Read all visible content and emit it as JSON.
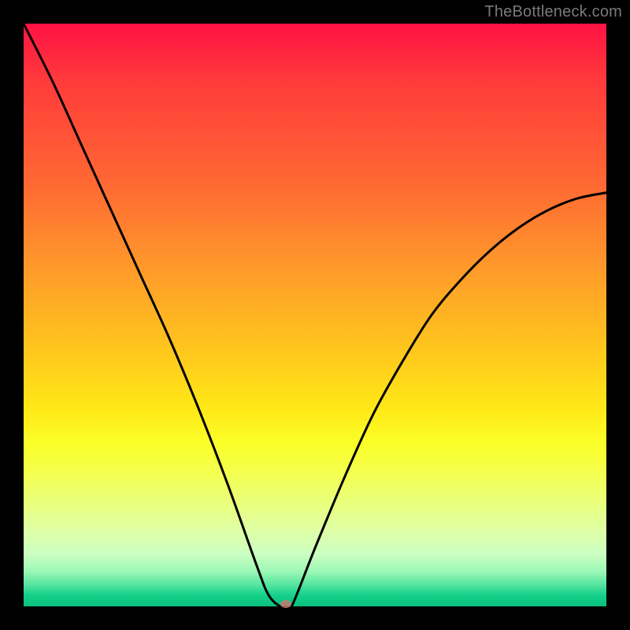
{
  "watermark": "TheBottleneck.com",
  "chart_data": {
    "type": "line",
    "title": "",
    "xlabel": "",
    "ylabel": "",
    "xlim": [
      0,
      100
    ],
    "ylim": [
      0,
      100
    ],
    "grid": false,
    "series": [
      {
        "name": "curve",
        "x": [
          0,
          5,
          10,
          15,
          20,
          25,
          30,
          35,
          40,
          42,
          44,
          45,
          46,
          50,
          55,
          60,
          65,
          70,
          75,
          80,
          85,
          90,
          95,
          100
        ],
        "y": [
          100,
          90,
          79,
          68,
          57,
          46,
          34,
          21,
          7,
          2,
          0,
          0,
          0,
          10,
          22,
          33,
          42,
          50,
          56,
          61,
          65,
          68,
          70,
          71
        ]
      }
    ],
    "marker": {
      "x": 45,
      "y": 0,
      "color": "#c57a6e"
    },
    "colors": {
      "curve": "#000000",
      "background_top": "#ff1244",
      "background_bottom": "#09c07e",
      "frame": "#000000"
    }
  }
}
